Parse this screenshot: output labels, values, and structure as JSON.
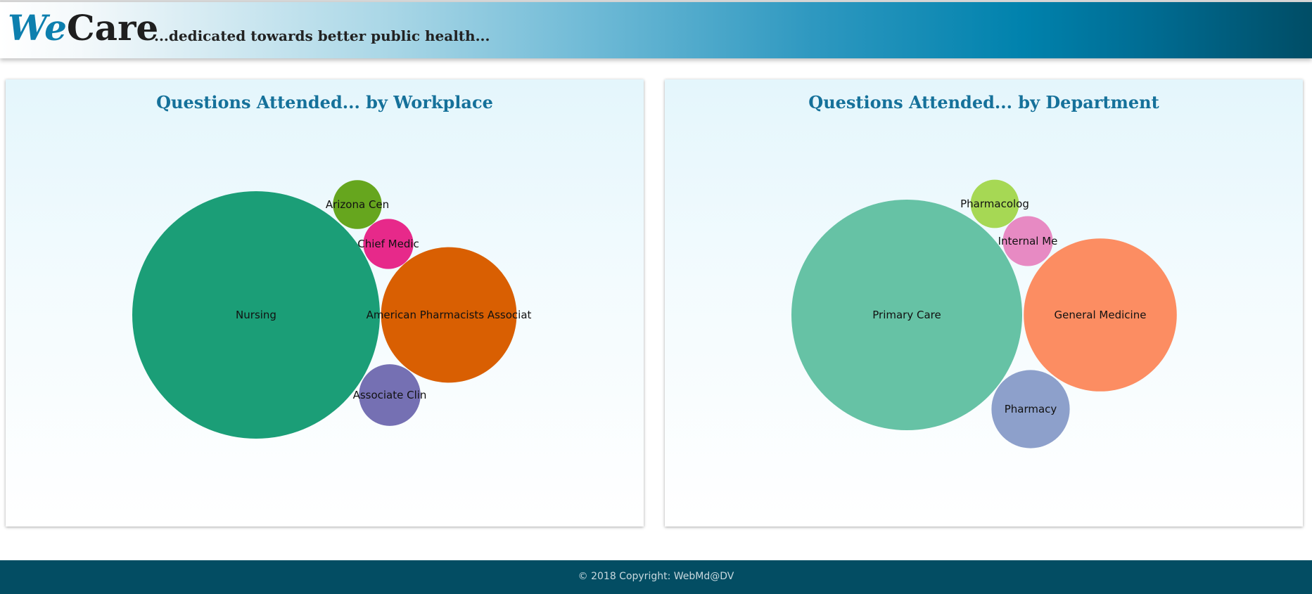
{
  "header": {
    "logo_we": "We",
    "logo_care": "Care",
    "tagline": "...dedicated towards better public health..."
  },
  "panels": [
    {
      "title": "Questions Attended... by Workplace",
      "chart_data": {
        "type": "bubble",
        "title": "Questions Attended... by Workplace",
        "bubbles": [
          {
            "label": "Nursing",
            "value": 100,
            "color": "#1b9e77"
          },
          {
            "label": "American Pharmacists Associat",
            "value": 30,
            "color": "#d95f02"
          },
          {
            "label": "Associate Clin",
            "value": 6.2,
            "color": "#7570b3"
          },
          {
            "label": "Chief Medic",
            "value": 4.1,
            "color": "#e7298a"
          },
          {
            "label": "Arizona Cen",
            "value": 3.9,
            "color": "#66a61e"
          }
        ]
      }
    },
    {
      "title": "Questions Attended... by Department",
      "chart_data": {
        "type": "bubble",
        "title": "Questions Attended... by Department",
        "bubbles": [
          {
            "label": "Primary Care",
            "value": 100,
            "color": "#66c2a5"
          },
          {
            "label": "General Medicine",
            "value": 44,
            "color": "#fc8d62"
          },
          {
            "label": "Pharmacy",
            "value": 11.5,
            "color": "#8da0cb"
          },
          {
            "label": "Internal Me",
            "value": 4.7,
            "color": "#e78ac3"
          },
          {
            "label": "Pharmacolog",
            "value": 4.4,
            "color": "#a6d854"
          }
        ]
      }
    }
  ],
  "footer": {
    "copyright": "© 2018 Copyright: WebMd@DV"
  }
}
